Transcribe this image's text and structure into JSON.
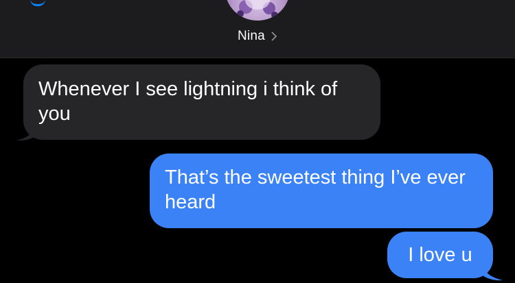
{
  "header": {
    "contact_name": "Nina",
    "avatar_icon": "contact-avatar-icon",
    "chevron_icon": "chevron-right-icon"
  },
  "colors": {
    "background": "#000000",
    "header_background": "#1c1c1e",
    "received_bubble": "#262629",
    "sent_bubble": "#3b82f6",
    "text": "#ffffff"
  },
  "messages": [
    {
      "direction": "received",
      "text": "Whenever I see lightning i think of you"
    },
    {
      "direction": "sent",
      "text": "That’s the sweetest thing I’ve ever heard"
    },
    {
      "direction": "sent",
      "text": "I love u"
    }
  ]
}
